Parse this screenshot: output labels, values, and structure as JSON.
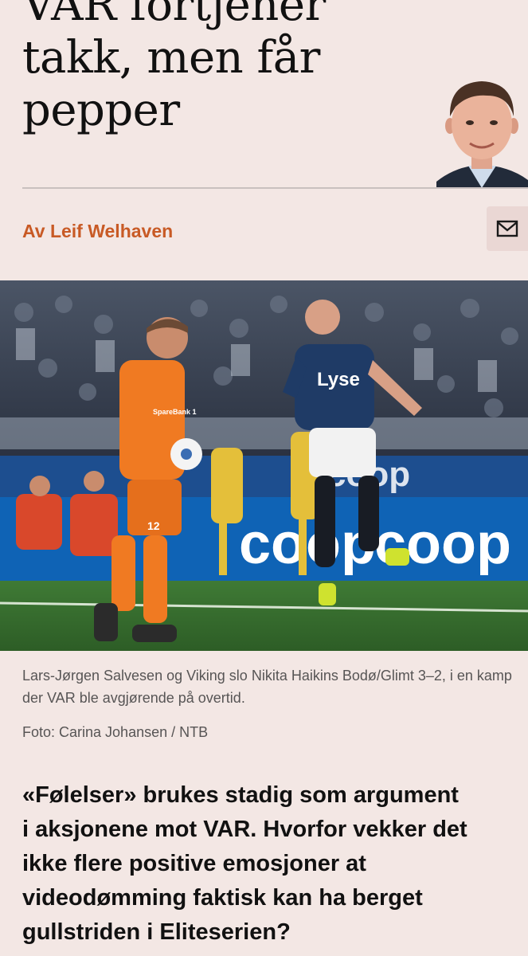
{
  "article": {
    "headline_lines": [
      "VAR fortjener",
      "takk, men får",
      "pepper"
    ],
    "byline": "Av Leif Welhaven",
    "author_photo_icon": "author-portrait",
    "mail_icon": "envelope-icon",
    "hero_image": {
      "description_icon": "football-match-photo",
      "sponsor_texts": [
        "Lyse",
        "coop",
        "coop",
        "coop",
        "SpareBank 1"
      ],
      "shirt_numbers": [
        "12"
      ]
    },
    "caption": "Lars-Jørgen Salvesen og Viking slo Nikita Haikins Bodø/Glimt 3–2, i en kamp der VAR ble avgjørende på overtid.",
    "photo_credit": "Foto: Carina Johansen / NTB",
    "lead_lines": [
      "«Følelser» brukes stadig som argument",
      "i aksjonene mot VAR. Hvorfor vekker det",
      "ikke flere positive emosjoner at",
      "videodømming faktisk kan ha berget",
      "gullstriden i Eliteserien?"
    ]
  },
  "colors": {
    "background": "#f3e7e4",
    "byline": "#c85a25",
    "caption": "#575555",
    "mail_button_bg": "#ead7d4"
  }
}
